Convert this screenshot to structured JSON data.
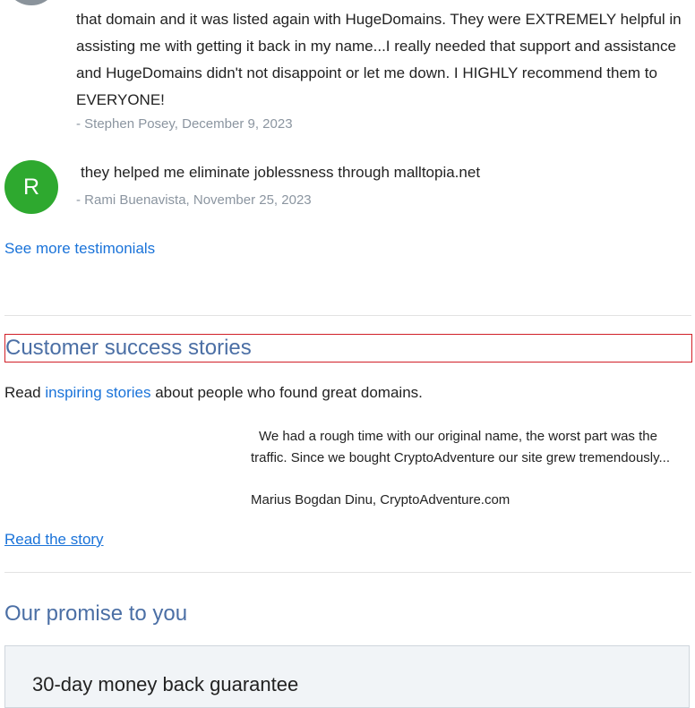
{
  "testimonials": [
    {
      "avatar_initial": "",
      "text": "that domain and it was listed again with HugeDomains. They were EXTREMELY helpful in assisting me with getting it back in my name...I really needed that support and assistance and HugeDomains didn't not disappoint or let me down. I HIGHLY recommend them to EVERYONE!",
      "author": "- Stephen Posey, December 9, 2023"
    },
    {
      "avatar_initial": "R",
      "text": "they helped me eliminate joblessness through malltopia.net",
      "author": "- Rami Buenavista, November 25, 2023"
    }
  ],
  "see_more": "See more testimonials",
  "success": {
    "title": "Customer success stories",
    "intro_prefix": "Read ",
    "intro_link": "inspiring stories",
    "intro_suffix": " about people who found great domains.",
    "quote": "We had a rough time with our original name, the worst part was the traffic. Since we bought CryptoAdventure our site grew tremendously...",
    "quote_author": "Marius Bogdan Dinu, CryptoAdventure.com",
    "read_story": "Read the story"
  },
  "promise": {
    "title": "Our promise to you",
    "guarantee_title": "30-day money back guarantee"
  },
  "colors": {
    "accent_link": "#1a73d9",
    "heading": "#4b6fa5",
    "avatar_green": "#2ea92f",
    "highlight_border": "#d11f27"
  }
}
